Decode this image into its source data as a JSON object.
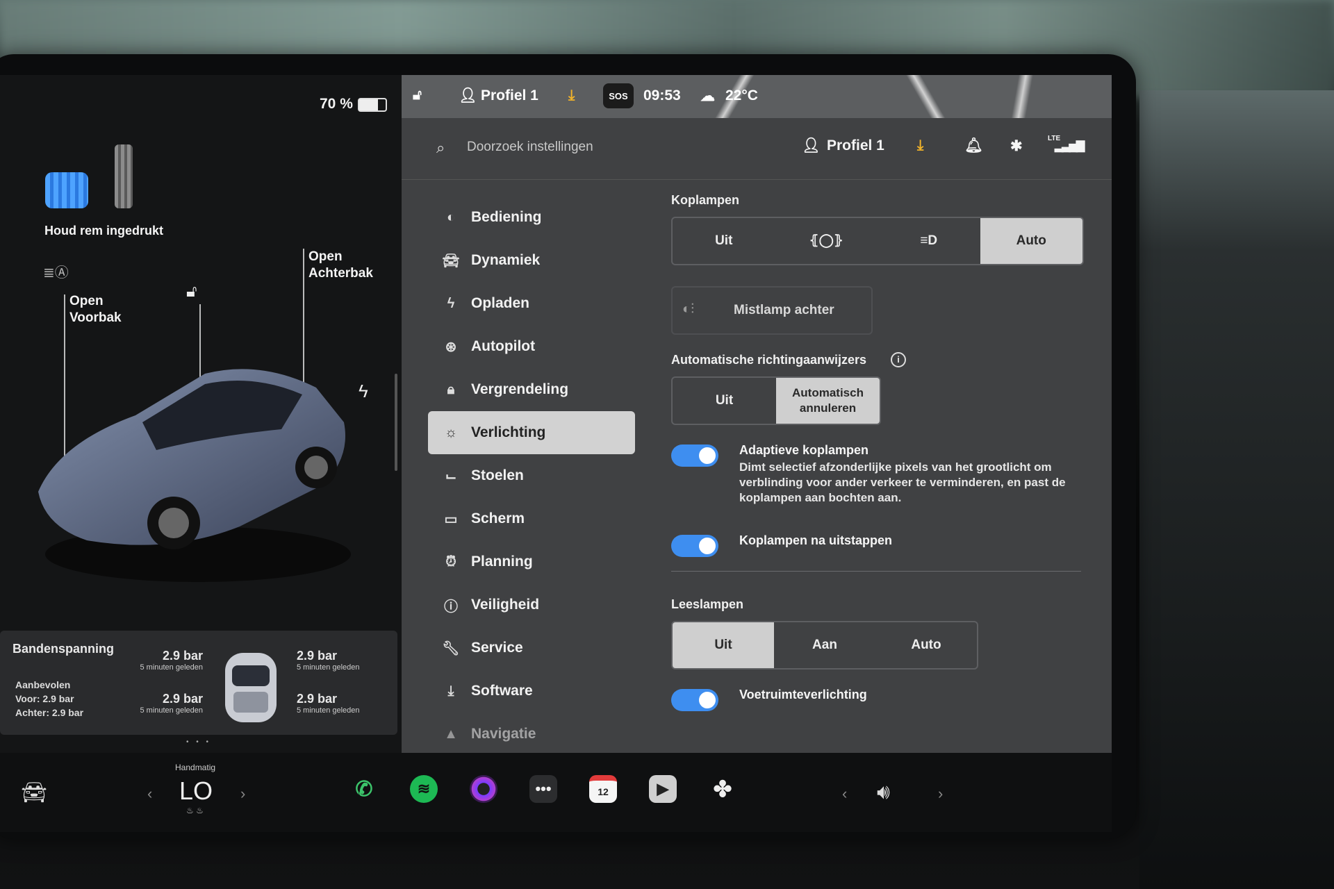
{
  "status": {
    "battery": "70 %",
    "battery_level": 0.7
  },
  "car_view": {
    "brake_hint": "Houd rem ingedrukt",
    "frunk_label": "Open\nVoorbak",
    "trunk_label": "Open\nAchterbak"
  },
  "tires": {
    "title": "Bandenspanning",
    "recommended_label": "Aanbevolen",
    "recommended_front": "Voor: 2.9 bar",
    "recommended_rear": "Achter: 2.9 bar",
    "fl": {
      "value": "2.9 bar",
      "age": "5 minuten geleden"
    },
    "fr": {
      "value": "2.9 bar",
      "age": "5 minuten geleden"
    },
    "rl": {
      "value": "2.9 bar",
      "age": "5 minuten geleden"
    },
    "rr": {
      "value": "2.9 bar",
      "age": "5 minuten geleden"
    }
  },
  "top_strip": {
    "profile": "Profiel 1",
    "sos": "SOS",
    "time": "09:53",
    "temperature": "22°C"
  },
  "header": {
    "search_placeholder": "Doorzoek instellingen",
    "profile": "Profiel 1",
    "network": "LTE"
  },
  "nav": {
    "items": [
      {
        "label": "Bediening",
        "icon": "toggle-icon"
      },
      {
        "label": "Dynamiek",
        "icon": "car-icon"
      },
      {
        "label": "Opladen",
        "icon": "bolt-icon"
      },
      {
        "label": "Autopilot",
        "icon": "steering-wheel-icon"
      },
      {
        "label": "Vergrendeling",
        "icon": "lock-icon"
      },
      {
        "label": "Verlichting",
        "icon": "sun-icon"
      },
      {
        "label": "Stoelen",
        "icon": "seat-icon"
      },
      {
        "label": "Scherm",
        "icon": "display-icon"
      },
      {
        "label": "Planning",
        "icon": "alarm-clock-icon"
      },
      {
        "label": "Veiligheid",
        "icon": "info-circle-icon"
      },
      {
        "label": "Service",
        "icon": "wrench-icon"
      },
      {
        "label": "Software",
        "icon": "download-icon"
      },
      {
        "label": "Navigatie",
        "icon": "navigation-arrow-icon"
      }
    ],
    "active": "Verlichting"
  },
  "lighting": {
    "headlights": {
      "title": "Koplampen",
      "options": [
        "Uit",
        "",
        "",
        "Auto"
      ],
      "selected": "Auto"
    },
    "rear_fog": {
      "label": "Mistlamp achter"
    },
    "auto_indicators": {
      "title": "Automatische richtingaanwijzers",
      "options": [
        "Uit",
        "Automatisch annuleren"
      ],
      "selected": "Automatisch annuleren"
    },
    "adaptive": {
      "title": "Adaptieve koplampen",
      "desc": "Dimt selectief afzonderlijke pixels van het grootlicht om verblinding voor ander verkeer te verminderen, en past de koplampen aan bochten aan.",
      "on": true
    },
    "after_exit": {
      "title": "Koplampen na uitstappen",
      "on": true
    },
    "reading": {
      "title": "Leeslampen",
      "options": [
        "Uit",
        "Aan",
        "Auto"
      ],
      "selected": "Uit"
    },
    "footwell": {
      "title": "Voetruimteverlichting",
      "on": true
    }
  },
  "dock": {
    "climate_mode": "Handmatig",
    "temperature": "LO",
    "calendar_day": "12"
  },
  "colors": {
    "accent": "#3e8ef0",
    "panel": "#404143",
    "selected": "#d2d2d2"
  }
}
